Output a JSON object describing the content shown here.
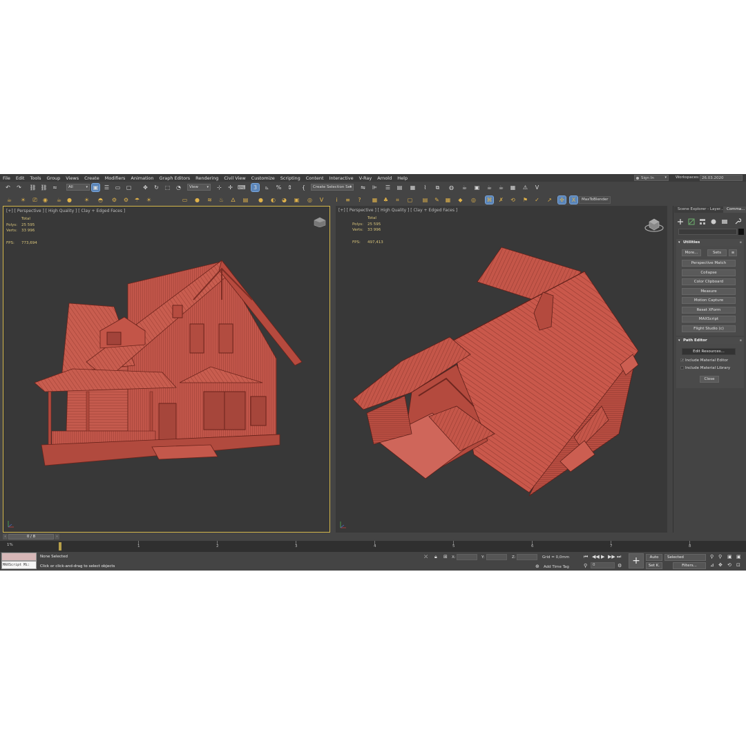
{
  "menu": [
    "File",
    "Edit",
    "Tools",
    "Group",
    "Views",
    "Create",
    "Modifiers",
    "Animation",
    "Graph Editors",
    "Rendering",
    "Civil View",
    "Customize",
    "Scripting",
    "Content",
    "Interactive",
    "V-Ray",
    "Arnold",
    "Help"
  ],
  "account": {
    "sign_in": "Sign In",
    "workspaces_label": "Workspaces:",
    "workspace_value": "26.03.2020"
  },
  "toolbar": {
    "filter_value": "All",
    "refcoord_value": "View",
    "selection_set_value": "Create Selection Set",
    "plugin_button": "MaxToBlender"
  },
  "viewports": {
    "left": {
      "label": "[+] [ Perspective ] [ High Quality ] [ Clay + Edged Faces ]",
      "total": "Total",
      "polys_label": "Polys:",
      "polys": "25 595",
      "verts_label": "Verts:",
      "verts": "33 996",
      "fps_label": "FPS:",
      "fps": "773,694"
    },
    "right": {
      "label": "[+] [ Perspective ] [ High Quality ] [ Clay + Edged Faces ]",
      "total": "Total",
      "polys_label": "Polys:",
      "polys": "25 595",
      "verts_label": "Verts:",
      "verts": "33 996",
      "fps_label": "FPS:",
      "fps": "497,413"
    }
  },
  "command_panel": {
    "tabs": [
      "Scene Explorer - Layer...",
      "Comma..."
    ],
    "utilities": {
      "title": "Utilities",
      "more_button": "More...",
      "sets_button": "Sets",
      "items": [
        "Perspective Match",
        "Collapse",
        "Color Clipboard",
        "Measure",
        "Motion Capture",
        "Reset XForm",
        "MAXScript",
        "Flight Studio (c)"
      ]
    },
    "path_editor": {
      "title": "Path Editor",
      "edit_button": "Edit Resources...",
      "check1_label": "Include Material Editor",
      "check1_checked": true,
      "check2_label": "Include Material Library",
      "check2_checked": false,
      "close_button": "Close"
    }
  },
  "timeline": {
    "slider_value": "0 / 8",
    "percent_label": "1%",
    "ticks": [
      "1",
      "2",
      "3",
      "4",
      "5",
      "6",
      "7",
      "8"
    ]
  },
  "status": {
    "maxscript_label": "MAXScript Mi:",
    "selection": "None Selected",
    "prompt": "Click or click-and-drag to select objects",
    "x_label": "X:",
    "y_label": "Y:",
    "z_label": "Z:",
    "grid": "Grid = 0,0mm",
    "add_time_tag": "Add Time Tag",
    "auto_button": "Auto",
    "set_key_button": "Set K.",
    "key_filter_value": "Selected",
    "filters_button": "Filters...",
    "frame_value": "0"
  },
  "colors": {
    "model_fill": "#c2564a",
    "model_dark": "#8a3026",
    "active_border": "#d3b64a",
    "accent_blue": "#5b85b8"
  }
}
